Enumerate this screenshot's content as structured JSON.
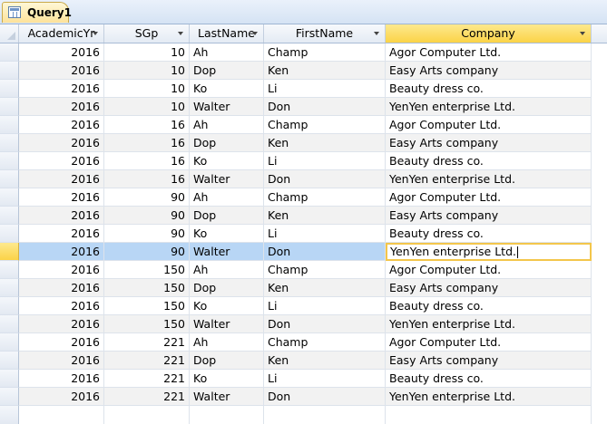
{
  "tab": {
    "label": "Query1",
    "icon": "query-datasheet-icon"
  },
  "columns": [
    {
      "label": "AcademicYr",
      "align": "right"
    },
    {
      "label": "SGp",
      "align": "right"
    },
    {
      "label": "LastName",
      "align": "left"
    },
    {
      "label": "FirstName",
      "align": "left"
    },
    {
      "label": "Company",
      "align": "left"
    }
  ],
  "current_row": 11,
  "active_column": 4,
  "colors": {
    "header_active": "#fbd347",
    "row_selected": "#b8d6f5",
    "alt_row": "#f2f2f2",
    "focus_border": "#f3c64b"
  },
  "rows": [
    [
      "2016",
      "10",
      "Ah",
      "Champ",
      "Agor Computer Ltd."
    ],
    [
      "2016",
      "10",
      "Dop",
      "Ken",
      "Easy Arts company"
    ],
    [
      "2016",
      "10",
      "Ko",
      "Li",
      "Beauty dress co."
    ],
    [
      "2016",
      "10",
      "Walter",
      "Don",
      "YenYen enterprise Ltd."
    ],
    [
      "2016",
      "16",
      "Ah",
      "Champ",
      "Agor Computer Ltd."
    ],
    [
      "2016",
      "16",
      "Dop",
      "Ken",
      "Easy Arts company"
    ],
    [
      "2016",
      "16",
      "Ko",
      "Li",
      "Beauty dress co."
    ],
    [
      "2016",
      "16",
      "Walter",
      "Don",
      "YenYen enterprise Ltd."
    ],
    [
      "2016",
      "90",
      "Ah",
      "Champ",
      "Agor Computer Ltd."
    ],
    [
      "2016",
      "90",
      "Dop",
      "Ken",
      "Easy Arts company"
    ],
    [
      "2016",
      "90",
      "Ko",
      "Li",
      "Beauty dress co."
    ],
    [
      "2016",
      "90",
      "Walter",
      "Don",
      "YenYen enterprise Ltd."
    ],
    [
      "2016",
      "150",
      "Ah",
      "Champ",
      "Agor Computer Ltd."
    ],
    [
      "2016",
      "150",
      "Dop",
      "Ken",
      "Easy Arts company"
    ],
    [
      "2016",
      "150",
      "Ko",
      "Li",
      "Beauty dress co."
    ],
    [
      "2016",
      "150",
      "Walter",
      "Don",
      "YenYen enterprise Ltd."
    ],
    [
      "2016",
      "221",
      "Ah",
      "Champ",
      "Agor Computer Ltd."
    ],
    [
      "2016",
      "221",
      "Dop",
      "Ken",
      "Easy Arts company"
    ],
    [
      "2016",
      "221",
      "Ko",
      "Li",
      "Beauty dress co."
    ],
    [
      "2016",
      "221",
      "Walter",
      "Don",
      "YenYen enterprise Ltd."
    ]
  ]
}
